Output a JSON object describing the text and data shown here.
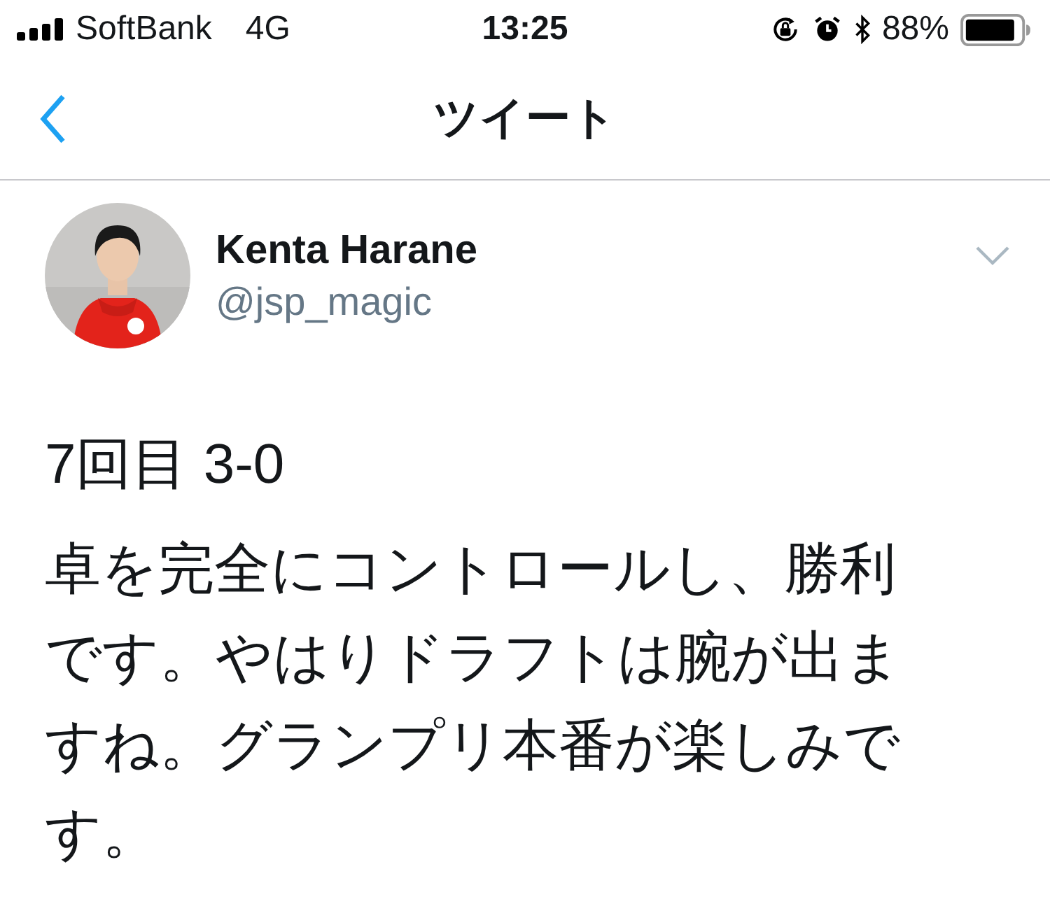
{
  "status_bar": {
    "carrier": "SoftBank",
    "network": "4G",
    "time": "13:25",
    "battery": "88%"
  },
  "nav": {
    "title": "ツイート"
  },
  "tweet": {
    "name": "Kenta Harane",
    "handle": "@jsp_magic",
    "paragraphs": [
      "7回目 3-0",
      "卓を完全にコントロールし、勝利です。やはりドラフトは腕が出ますね。グランプリ本番が楽しみです。"
    ]
  }
}
